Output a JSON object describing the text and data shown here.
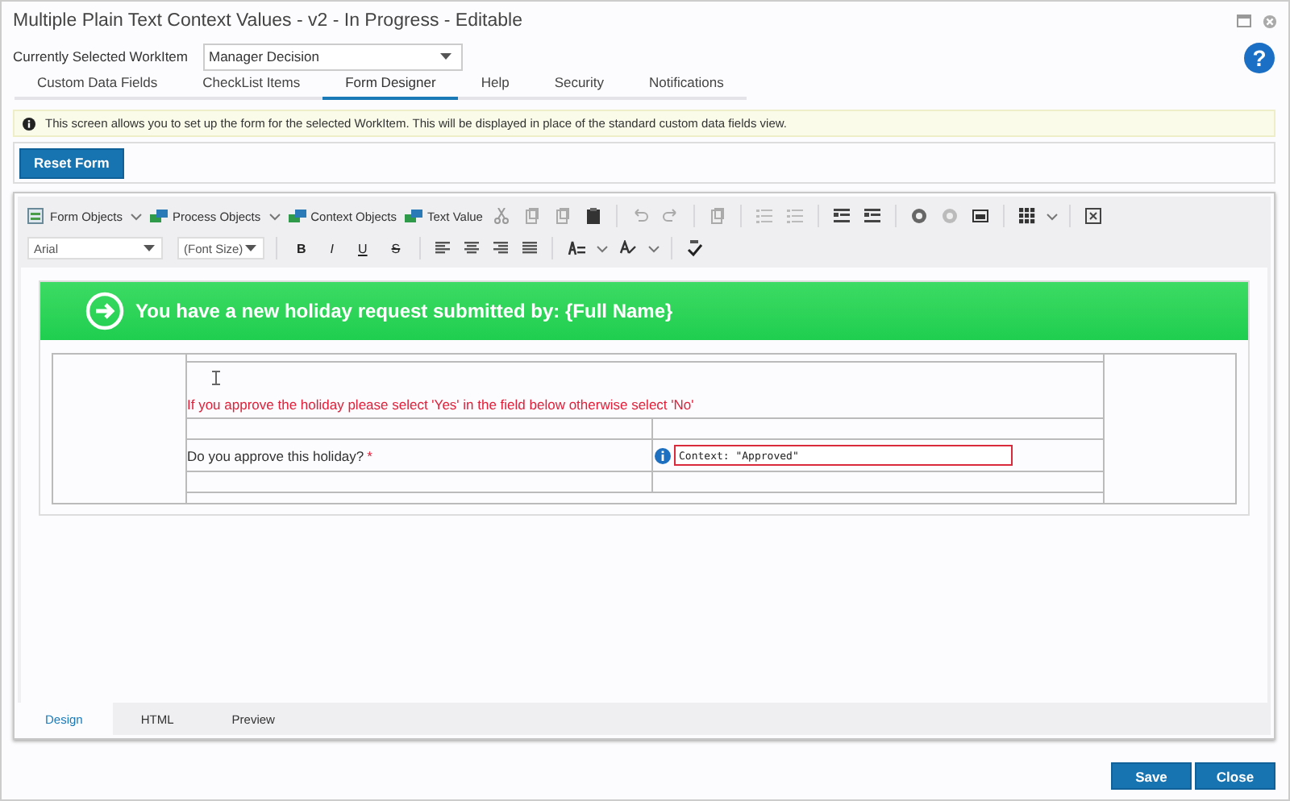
{
  "window": {
    "title": "Multiple Plain Text Context Values - v2 - In Progress - Editable"
  },
  "help_button": "?",
  "workitem": {
    "label": "Currently Selected WorkItem",
    "value": "Manager Decision"
  },
  "tabs": [
    {
      "label": "Custom Data Fields",
      "selected": false
    },
    {
      "label": "CheckList Items",
      "selected": false
    },
    {
      "label": "Form Designer",
      "selected": true
    },
    {
      "label": "Help",
      "selected": false
    },
    {
      "label": "Security",
      "selected": false
    },
    {
      "label": "Notifications",
      "selected": false
    }
  ],
  "info": "This screen allows you to set up the form for the selected WorkItem. This will be displayed in place of the standard custom data fields view.",
  "reset_button": "Reset Form",
  "toolbar": {
    "menus": [
      {
        "label": "Form Objects",
        "dropdown": true
      },
      {
        "label": "Process Objects",
        "dropdown": true
      },
      {
        "label": "Context Objects",
        "dropdown": false
      },
      {
        "label": "Text Value",
        "dropdown": false
      }
    ],
    "font": "Arial",
    "font_size": "(Font Size)",
    "format_buttons": [
      {
        "label": "B",
        "kind": "bold"
      },
      {
        "label": "I",
        "kind": "italic"
      },
      {
        "label": "U",
        "kind": "underline"
      },
      {
        "label": "S",
        "kind": "strike"
      }
    ]
  },
  "form": {
    "banner": "You have a new holiday request submitted by: {Full Name}",
    "instruction": "If you approve the holiday please select 'Yes' in the field below otherwise select 'No'",
    "question": "Do you approve this holiday?",
    "required_mark": "*",
    "field_value": "Context: \"Approved\""
  },
  "editor_tabs": [
    {
      "label": "Design",
      "selected": true
    },
    {
      "label": "HTML",
      "selected": false
    },
    {
      "label": "Preview",
      "selected": false
    }
  ],
  "buttons": [
    "Save",
    "Close"
  ]
}
